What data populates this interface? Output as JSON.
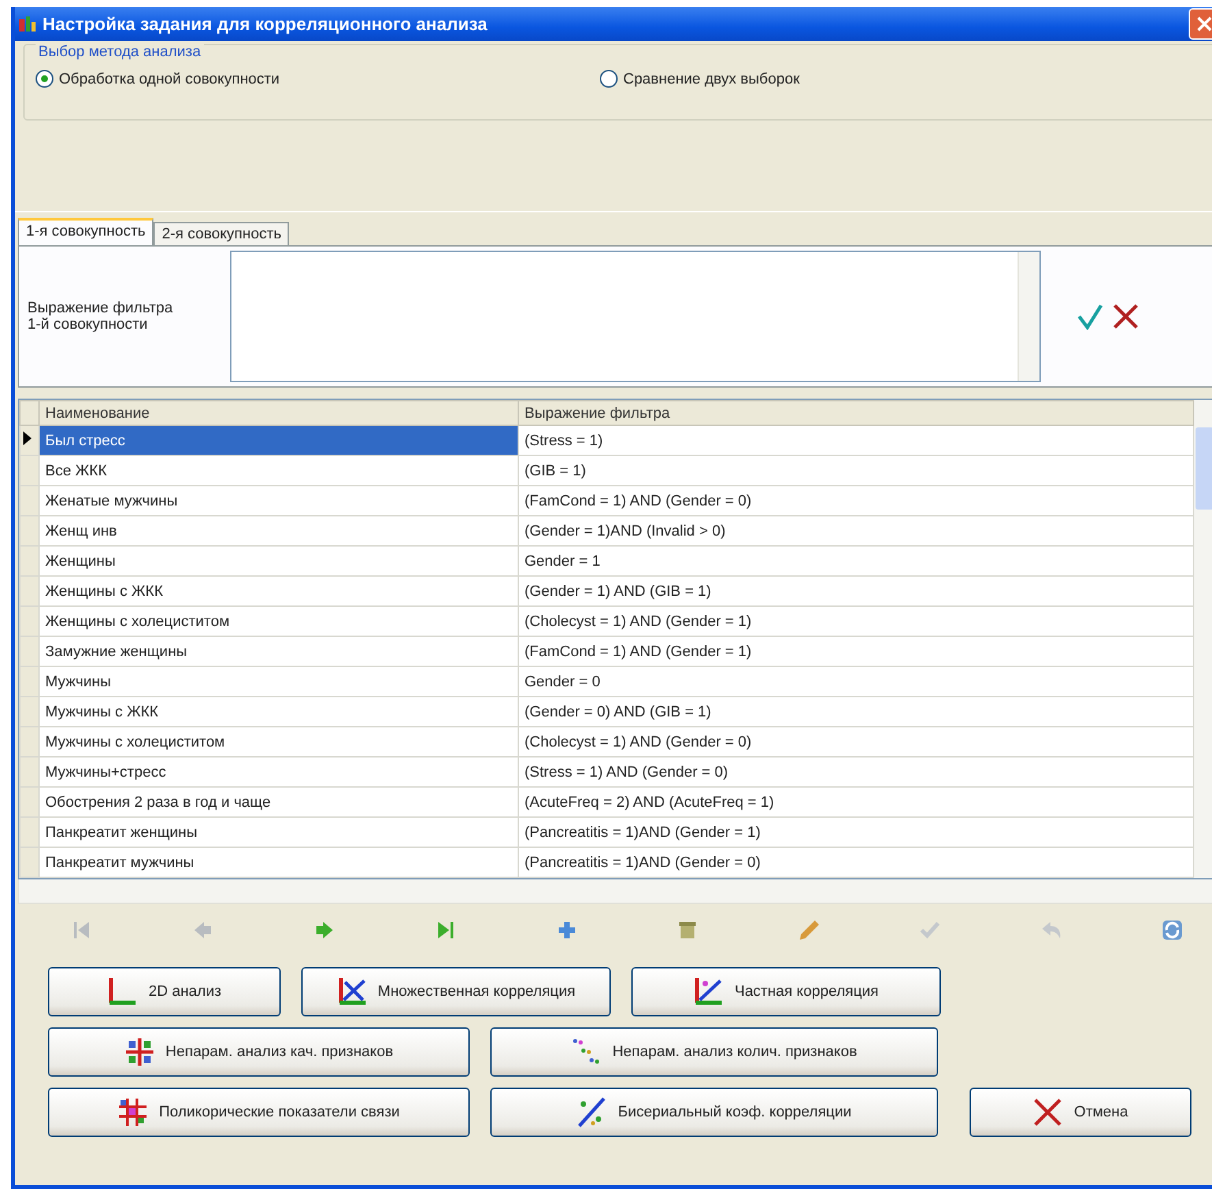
{
  "window": {
    "title": "Настройка задания для корреляционного анализа"
  },
  "method_group": {
    "title": "Выбор метода анализа",
    "options": [
      {
        "label": "Обработка одной совокупности",
        "selected": true
      },
      {
        "label": "Сравнение двух выборок",
        "selected": false
      }
    ]
  },
  "tabs": [
    {
      "label": "1-я совокупность",
      "selected": true
    },
    {
      "label": "2-я совокупность",
      "selected": false
    }
  ],
  "filter": {
    "label": "Выражение фильтра\n1-й совокупности"
  },
  "grid": {
    "columns": [
      "Наименование",
      "Выражение фильтра"
    ],
    "rows": [
      {
        "name": "Был стресс",
        "filter": "(Stress = 1)",
        "selected": true
      },
      {
        "name": "Все ЖКК",
        "filter": "(GIB = 1)",
        "selected": false
      },
      {
        "name": "Женатые мужчины",
        "filter": "(FamCond = 1) AND (Gender = 0)",
        "selected": false
      },
      {
        "name": "Женщ инв",
        "filter": "(Gender = 1)AND (Invalid > 0)",
        "selected": false
      },
      {
        "name": "Женщины",
        "filter": "Gender = 1",
        "selected": false
      },
      {
        "name": "Женщины с ЖКК",
        "filter": "(Gender = 1) AND (GIB = 1)",
        "selected": false
      },
      {
        "name": "Женщины с холециститом",
        "filter": "(Cholecyst = 1)  AND (Gender = 1)",
        "selected": false
      },
      {
        "name": "Замужние женщины",
        "filter": "(FamCond = 1)  AND (Gender = 1)",
        "selected": false
      },
      {
        "name": "Мужчины",
        "filter": "Gender = 0",
        "selected": false
      },
      {
        "name": "Мужчины с ЖКК",
        "filter": "(Gender = 0) AND (GIB = 1)",
        "selected": false
      },
      {
        "name": "Мужчины с холециститом",
        "filter": "(Cholecyst = 1)  AND (Gender = 0)",
        "selected": false
      },
      {
        "name": "Мужчины+стресс",
        "filter": "(Stress = 1) AND (Gender = 0)",
        "selected": false
      },
      {
        "name": "Обострения 2 раза в год и чаще",
        "filter": "(AcuteFreq = 2) AND (AcuteFreq = 1)",
        "selected": false
      },
      {
        "name": "Панкреатит женщины",
        "filter": "(Pancreatitis = 1)AND (Gender = 1)",
        "selected": false
      },
      {
        "name": "Панкреатит мужчины",
        "filter": "(Pancreatitis = 1)AND (Gender = 0)",
        "selected": false
      }
    ]
  },
  "navigator": [
    {
      "kind": "first",
      "disabled": true
    },
    {
      "kind": "prior",
      "disabled": true
    },
    {
      "kind": "next",
      "disabled": false
    },
    {
      "kind": "last",
      "disabled": false
    },
    {
      "kind": "insert",
      "disabled": false
    },
    {
      "kind": "delete",
      "disabled": false
    },
    {
      "kind": "edit",
      "disabled": false
    },
    {
      "kind": "post",
      "disabled": true
    },
    {
      "kind": "cancel",
      "disabled": true
    },
    {
      "kind": "refresh",
      "disabled": false
    }
  ],
  "button_rows": [
    [
      {
        "label": "2D анализ",
        "kind": "axes"
      },
      {
        "label": "Множественная корреляция",
        "kind": "multi"
      },
      {
        "label": "Частная корреляция",
        "kind": "partial"
      }
    ],
    [
      {
        "label": "Непарам. анализ кач. признаков",
        "kind": "table"
      },
      {
        "label": "Непарам. анализ колич. признаков",
        "kind": "scatter"
      }
    ],
    [
      {
        "label": "Поликорические показатели связи",
        "kind": "grid"
      },
      {
        "label": "Бисериальный коэф. корреляции",
        "kind": "biserial"
      },
      {
        "label": "Отмена",
        "kind": "cancel"
      }
    ]
  ]
}
